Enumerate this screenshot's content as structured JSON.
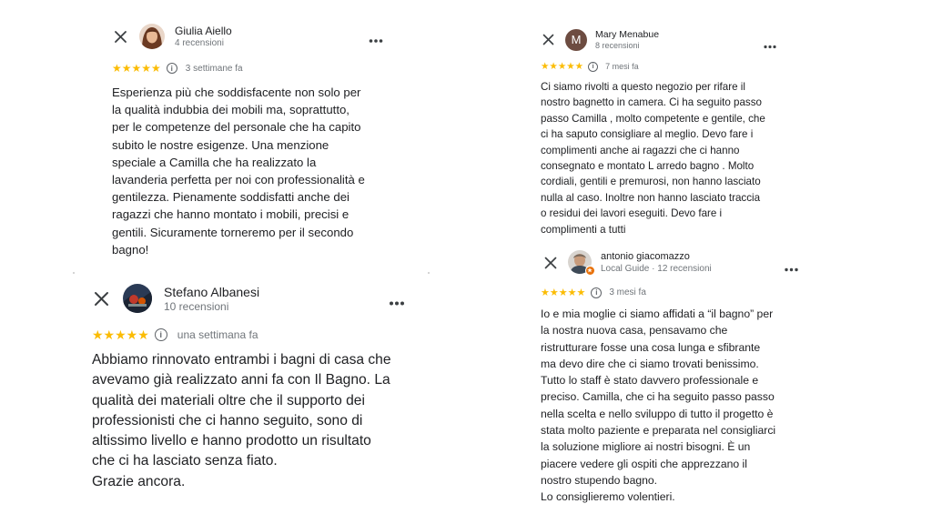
{
  "reviews": [
    {
      "author": "Giulia Aiello",
      "meta": "4 recensioni",
      "stars": "★★★★★",
      "time": "3 settimane fa",
      "lines": [
        "Esperienza più che soddisfacente non solo per",
        "la qualità indubbia dei mobili ma, soprattutto,",
        "per le competenze del personale che ha capito",
        "subito le nostre esigenze. Una menzione",
        "speciale a Camilla che ha realizzato la",
        "lavanderia perfetta per noi con professionalità e",
        "gentilezza. Pienamente soddisfatti anche dei",
        "ragazzi che hanno montato i mobili, precisi e",
        "gentili. Sicuramente torneremo per il secondo",
        "bagno!"
      ]
    },
    {
      "author": "Stefano Albanesi",
      "meta": "10 recensioni",
      "stars": "★★★★★",
      "time": "una settimana fa",
      "lines": [
        "Abbiamo rinnovato entrambi i bagni di casa che",
        "avevamo già realizzato anni fa con Il Bagno. La",
        "qualità dei materiali oltre che il supporto dei",
        "professionisti che ci hanno seguito, sono di",
        "altissimo livello e hanno prodotto un risultato",
        "che ci ha lasciato senza fiato.",
        "Grazie ancora."
      ]
    },
    {
      "author": "Mary Menabue",
      "avatar_letter": "M",
      "meta": "8 recensioni",
      "stars": "★★★★★",
      "time": "7 mesi fa",
      "lines": [
        "Ci siamo rivolti a questo negozio per rifare il",
        "nostro bagnetto in camera. Ci ha seguito passo",
        "passo Camilla , molto competente e gentile, che",
        "ci ha saputo consigliare al meglio. Devo fare i",
        "complimenti anche ai ragazzi che ci hanno",
        "consegnato e montato L arredo bagno . Molto",
        "cordiali, gentili e premurosi, non hanno lasciato",
        "nulla al caso. Inoltre non hanno lasciato traccia",
        "o residui dei lavori eseguiti. Devo fare i",
        "complimenti a tutti"
      ]
    },
    {
      "author": "antonio giacomazzo",
      "meta": "Local Guide · 12 recensioni",
      "stars": "★★★★★",
      "time": "3 mesi fa",
      "lines": [
        "Io e mia moglie ci siamo affidati a “il bagno” per",
        "la nostra nuova casa, pensavamo che",
        "ristrutturare fosse una cosa lunga e sfibrante",
        "ma devo dire che ci siamo trovati benissimo.",
        "Tutto lo staff è stato davvero professionale e",
        "preciso. Camilla, che ci ha seguito passo passo",
        "nella scelta e  nello sviluppo di tutto il progetto è",
        "stata molto paziente e preparata nel consigliarci",
        "la soluzione migliore ai nostri bisogni. È un",
        "piacere vedere gli ospiti che apprezzano il",
        "nostro stupendo bagno.",
        "Lo consiglieremo volentieri."
      ]
    }
  ],
  "icons": {
    "close": "close-icon",
    "more": "more-vert-icon",
    "info": "info-icon",
    "star": "star-icon",
    "local_guide": "local-guide-badge-icon"
  },
  "colors": {
    "star": "#fbbc04",
    "text": "#202124",
    "muted": "#70757a",
    "local_guide": "#e8710a"
  }
}
